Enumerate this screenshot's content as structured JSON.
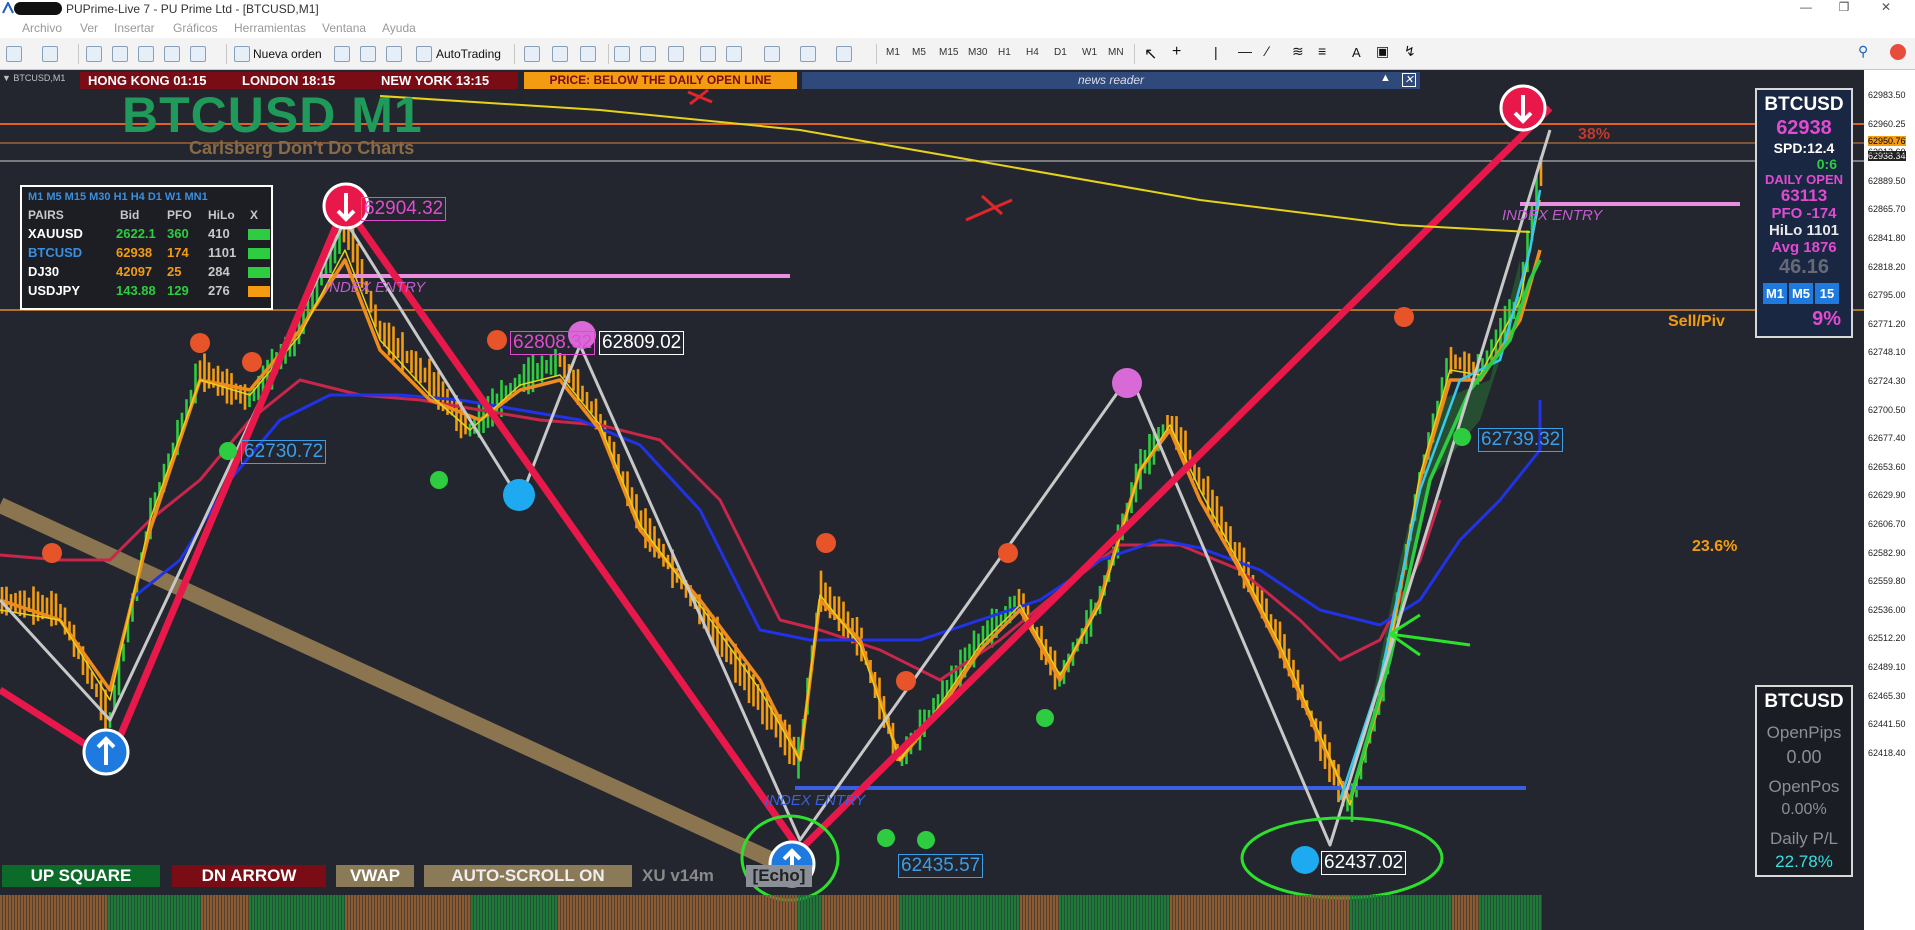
{
  "window": {
    "title": "PUPrime-Live 7 - PU Prime Ltd - [BTCUSD,M1]",
    "min_icon": "minimize-icon",
    "restore_icon": "restore-icon",
    "close_icon": "close-icon"
  },
  "menu": [
    "Archivo",
    "Ver",
    "Insertar",
    "Gráficos",
    "Herramientas",
    "Ventana",
    "Ayuda"
  ],
  "toolbar": {
    "new_order": "Nueva orden",
    "autotrading": "AutoTrading",
    "timeframes": [
      "M1",
      "M5",
      "M15",
      "M30",
      "H1",
      "H4",
      "D1",
      "W1",
      "MN"
    ],
    "text_tool": "A"
  },
  "chart_header": {
    "symbol_label": "BTCUSD,M1",
    "hong_kong": "HONG KONG 01:15",
    "london": "LONDON  18:15",
    "new_york": "NEW YORK  13:15",
    "price_notice": "PRICE: BELOW THE DAILY OPEN LINE",
    "news_reader": "news reader"
  },
  "chart_title": "BTCUSD M1",
  "chart_subtitle": "Carlsberg Don't Do Charts",
  "pairs_table": {
    "timeframes": "M1   M5   M15  M30   H1    H4    D1    W1   MN1",
    "headers": [
      "PAIRS",
      "Bid",
      "PFO",
      "HiLo",
      "X"
    ],
    "rows": [
      {
        "pair": "XAUUSD",
        "bid": "2622.1",
        "pfo": "360",
        "hilo": "410",
        "color": "#2ecc40"
      },
      {
        "pair": "BTCUSD",
        "bid": "62938",
        "pfo": "174",
        "hilo": "1101",
        "color": "#2ecc40"
      },
      {
        "pair": "DJ30",
        "bid": "42097",
        "pfo": "25",
        "hilo": "284",
        "color": "#2ecc40"
      },
      {
        "pair": "USDJPY",
        "bid": "143.88",
        "pfo": "129",
        "hilo": "276",
        "color": "#f39c12"
      }
    ]
  },
  "info_panel": {
    "symbol": "BTCUSD",
    "price": "62938",
    "spread": "SPD:12.4",
    "timer": "0:6",
    "daily_open_label": "DAILY OPEN",
    "daily_open": "63113",
    "pfo": "PFO  -174",
    "hilo": "HiLo 1101",
    "avg": "Avg  1876",
    "value": "46.16",
    "tf_buttons": [
      "M1",
      "M5",
      "15"
    ],
    "percent": "9%"
  },
  "pl_panel": {
    "symbol": "BTCUSD",
    "open_pips_label": "OpenPips",
    "open_pips": "0.00",
    "open_pos_label": "OpenPos",
    "open_pos": "0.00%",
    "daily_pl_label": "Daily P/L",
    "daily_pl": "22.78%"
  },
  "bottom_buttons": {
    "up_square": "UP SQUARE",
    "dn_arrow": "DN ARROW",
    "vwap": "VWAP",
    "auto_scroll": "AUTO-SCROLL ON",
    "version": "XU v14m",
    "echo": "[Echo]"
  },
  "annotations": {
    "p1": "62904.32",
    "p2": "62808.32",
    "p3": "62809.02",
    "p4": "62730.72",
    "p5": "62435.57",
    "p6": "62437.02",
    "p7": "62739.32",
    "fib38": "38%",
    "fib23": "23.6%",
    "sell_piv": "Sell/Piv",
    "index_entry": "INDEX ENTRY"
  },
  "price_axis": [
    "62983.50",
    "62960.25",
    "62950.76",
    "62938.34",
    "62912.60",
    "62889.50",
    "62865.70",
    "62841.80",
    "62818.20",
    "62795.00",
    "62771.20",
    "62748.10",
    "62724.30",
    "62700.50",
    "62677.40",
    "62653.60",
    "62629.90",
    "62606.70",
    "62582.90",
    "62559.80",
    "62536.00",
    "62512.20",
    "62489.10",
    "62465.30",
    "62441.50",
    "62418.40"
  ],
  "colors": {
    "up": "#2ecc40",
    "down": "#f39c12",
    "zigzag": "#e8194a",
    "vwap_line": "#2033e6",
    "ma_red": "#c8264a",
    "yellow_line": "#e6d21a",
    "blue_level": "#3a5fe0",
    "pink_level": "#e88fe0"
  }
}
